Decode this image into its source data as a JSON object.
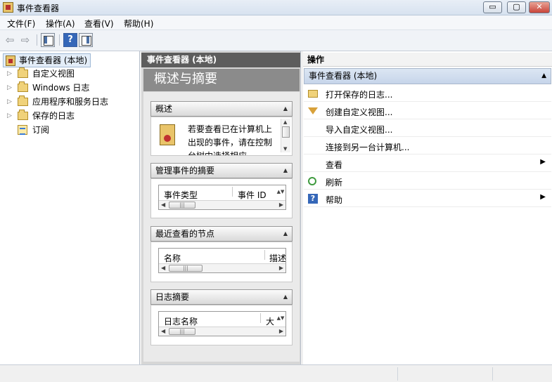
{
  "window": {
    "title": "事件查看器",
    "controls": {
      "minimize": "▭",
      "maximize": "▢",
      "close": "✕"
    }
  },
  "menu": [
    "文件(F)",
    "操作(A)",
    "查看(V)",
    "帮助(H)"
  ],
  "toolbar": {
    "icons": [
      "back-arrow-icon",
      "forward-arrow-icon",
      "show-hide-console-tree-icon",
      "help-icon",
      "show-hide-action-pane-icon"
    ],
    "back": "⇦",
    "forward": "⇨",
    "help": "?"
  },
  "tree": {
    "root": "事件查看器 (本地)",
    "items": [
      {
        "label": "自定义视图",
        "expandable": true,
        "arrow": "▷"
      },
      {
        "label": "Windows 日志",
        "expandable": true,
        "arrow": "▷"
      },
      {
        "label": "应用程序和服务日志",
        "expandable": true,
        "arrow": "▷"
      },
      {
        "label": "保存的日志",
        "expandable": true,
        "arrow": "▷"
      },
      {
        "label": "订阅",
        "expandable": false,
        "arrow": ""
      }
    ]
  },
  "middle": {
    "header": "事件查看器 (本地)",
    "banner": "概述与摘要",
    "sections": {
      "overview": {
        "title": "概述",
        "text": "若要查看已在计算机上出现的事件，请在控制台树中选择相应"
      },
      "admin_events": {
        "title": "管理事件的摘要",
        "columns": [
          "事件类型",
          "事件 ID"
        ]
      },
      "recent_nodes": {
        "title": "最近查看的节点",
        "columns": [
          "名称",
          "描述"
        ]
      },
      "log_summary": {
        "title": "日志摘要",
        "columns": [
          "日志名称",
          "大"
        ]
      }
    },
    "glyphs": {
      "collapse": "▲",
      "scroll_left": "◀",
      "scroll_right": "▶",
      "scroll_up": "▲",
      "scroll_down": "▼",
      "spin": "▲▼",
      "grip": "|||"
    }
  },
  "actions": {
    "title": "操作",
    "group": "事件查看器 (本地)",
    "group_arrow": "▲",
    "items": [
      {
        "label": "打开保存的日志...",
        "icon": "open-folder-icon",
        "submenu": ""
      },
      {
        "label": "创建自定义视图...",
        "icon": "filter-icon",
        "submenu": ""
      },
      {
        "label": "导入自定义视图...",
        "icon": "",
        "submenu": ""
      },
      {
        "label": "连接到另一台计算机...",
        "icon": "",
        "submenu": ""
      },
      {
        "label": "查看",
        "icon": "",
        "submenu": "▶"
      },
      {
        "label": "刷新",
        "icon": "refresh-icon",
        "submenu": ""
      },
      {
        "label": "帮助",
        "icon": "help-icon",
        "submenu": "▶"
      }
    ]
  },
  "status": [
    "",
    "",
    ""
  ]
}
